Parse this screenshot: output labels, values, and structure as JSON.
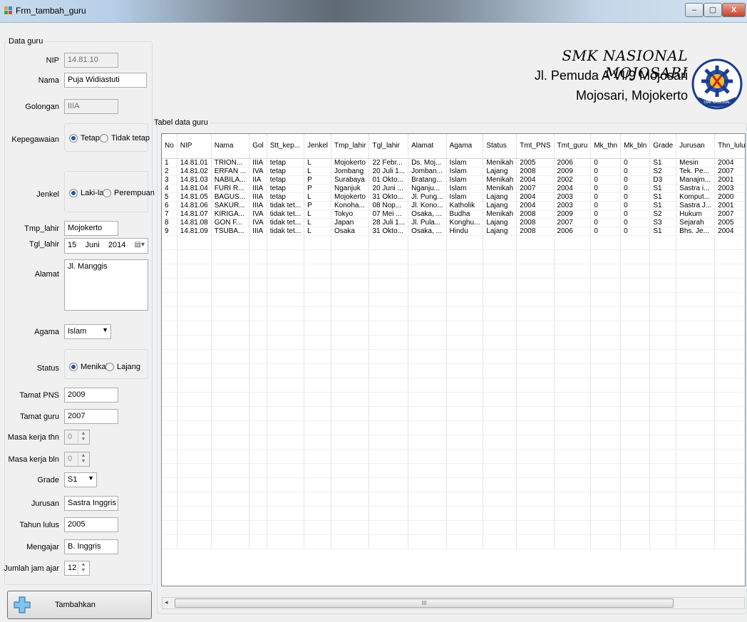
{
  "window": {
    "title": "Frm_tambah_guru",
    "minimize": "–",
    "maximize": "▢",
    "close": "X"
  },
  "header": {
    "school": "SMK NASIONAL MOJOSARI",
    "address1": "Jl. Pemuda A VI/9 Mojosari",
    "address2": "Mojosari, Mojokerto",
    "logo_text": "SMK NASIONAL"
  },
  "form": {
    "group_label": "Data guru",
    "nip": {
      "label": "NIP",
      "value": "14.81.10"
    },
    "nama": {
      "label": "Nama",
      "value": "Puja Widiastuti"
    },
    "golongan": {
      "label": "Golongan",
      "value": "IIIA"
    },
    "kepegawaian": {
      "label": "Kepegawaian",
      "opt1": "Tetap",
      "opt2": "Tidak tetap",
      "selected": "Tetap"
    },
    "jenkel": {
      "label": "Jenkel",
      "opt1": "Laki-laki",
      "opt2": "Perempuan",
      "selected": "Laki-laki"
    },
    "tmp_lahir": {
      "label": "Tmp_lahir",
      "value": "Mojokerto"
    },
    "tgl_lahir": {
      "label": "Tgl_lahir",
      "day": "15",
      "month": "Juni",
      "year": "2014"
    },
    "alamat": {
      "label": "Alamat",
      "value": "Jl. Manggis"
    },
    "agama": {
      "label": "Agama",
      "value": "Islam"
    },
    "status": {
      "label": "Status",
      "opt1": "Menikah",
      "opt2": "Lajang",
      "selected": "Menikah"
    },
    "tamat_pns": {
      "label": "Tamat PNS",
      "value": "2009"
    },
    "tamat_guru": {
      "label": "Tamat guru",
      "value": "2007"
    },
    "masa_kerja_thn": {
      "label": "Masa kerja thn",
      "value": "0"
    },
    "masa_kerja_bln": {
      "label": "Masa kerja bln",
      "value": "0"
    },
    "grade": {
      "label": "Grade",
      "value": "S1"
    },
    "jurusan": {
      "label": "Jurusan",
      "value": "Sastra Inggris"
    },
    "tahun_lulus": {
      "label": "Tahun lulus",
      "value": "2005"
    },
    "mengajar": {
      "label": "Mengajar",
      "value": "B. Inggris"
    },
    "jumlah_jam_ajar": {
      "label": "Jumlah jam ajar",
      "value": "12"
    },
    "tambahkan": {
      "label": "Tambahkan"
    }
  },
  "table": {
    "group_label": "Tabel data guru",
    "columns": [
      "No",
      "NIP",
      "Nama",
      "Gol",
      "Stt_kep...",
      "Jenkel",
      "Tmp_lahir",
      "Tgl_lahir",
      "Alamat",
      "Agama",
      "Status",
      "Tmt_PNS",
      "Tmt_guru",
      "Mk_thn",
      "Mk_bln",
      "Grade",
      "Jurusan",
      "Thn_lulus"
    ],
    "rows": [
      [
        "1",
        "14.81.01",
        "TRION...",
        "IIIA",
        "tetap",
        "L",
        "Mojokerto",
        "22 Febr...",
        "Ds. Moj...",
        "Islam",
        "Menikah",
        "2005",
        "2006",
        "0",
        "0",
        "S1",
        "Mesin",
        "2004"
      ],
      [
        "2",
        "14.81.02",
        "ERFAN ...",
        "IVA",
        "tetap",
        "L",
        "Jombang",
        "20 Juli 1...",
        "Jomban...",
        "Islam",
        "Lajang",
        "2008",
        "2009",
        "0",
        "0",
        "S2",
        "Tek. Pe...",
        "2007"
      ],
      [
        "3",
        "14.81.03",
        "NABILA...",
        "IIA",
        "tetap",
        "P",
        "Surabaya",
        "01 Okto...",
        "Bratang...",
        "Islam",
        "Menikah",
        "2004",
        "2002",
        "0",
        "0",
        "D3",
        "Manajm...",
        "2001"
      ],
      [
        "4",
        "14.81.04",
        "FURI R...",
        "IIIA",
        "tetap",
        "P",
        "Nganjuk",
        "20 Juni ...",
        "Nganju...",
        "Islam",
        "Menikah",
        "2007",
        "2004",
        "0",
        "0",
        "S1",
        "Sastra i...",
        "2003"
      ],
      [
        "5",
        "14.81.05",
        "BAGUS...",
        "IIIA",
        "tetap",
        "L",
        "Mojokerto",
        "31 Okto...",
        "Jl. Pung...",
        "Islam",
        "Lajang",
        "2004",
        "2003",
        "0",
        "0",
        "S1",
        "Komput...",
        "2000"
      ],
      [
        "6",
        "14.81.06",
        "SAKUR...",
        "IIIA",
        "tidak tet...",
        "P",
        "Konoha...",
        "08 Nop...",
        "Jl. Kono...",
        "Katholik",
        "Lajang",
        "2004",
        "2003",
        "0",
        "0",
        "S1",
        "Sastra J...",
        "2001"
      ],
      [
        "7",
        "14.81.07",
        "KIRIGA...",
        "IVA",
        "tidak tet...",
        "L",
        "Tokyo",
        "07 Mei ...",
        "Osaka, ...",
        "Budha",
        "Menikah",
        "2008",
        "2009",
        "0",
        "0",
        "S2",
        "Hukum",
        "2007"
      ],
      [
        "8",
        "14.81.08",
        "GON F...",
        "IVA",
        "tidak tet...",
        "L",
        "Japan",
        "28 Juli 1...",
        "Jl. Pula...",
        "Konghu...",
        "Lajang",
        "2008",
        "2007",
        "0",
        "0",
        "S3",
        "Sejarah",
        "2005"
      ],
      [
        "9",
        "14.81.09",
        "TSUBA...",
        "IIIA",
        "tidak tet...",
        "L",
        "Osaka",
        "31 Okto...",
        "Osaka, ...",
        "Hindu",
        "Lajang",
        "2008",
        "2006",
        "0",
        "0",
        "S1",
        "Bhs. Je...",
        "2004"
      ]
    ],
    "scroll_grip": "III"
  }
}
